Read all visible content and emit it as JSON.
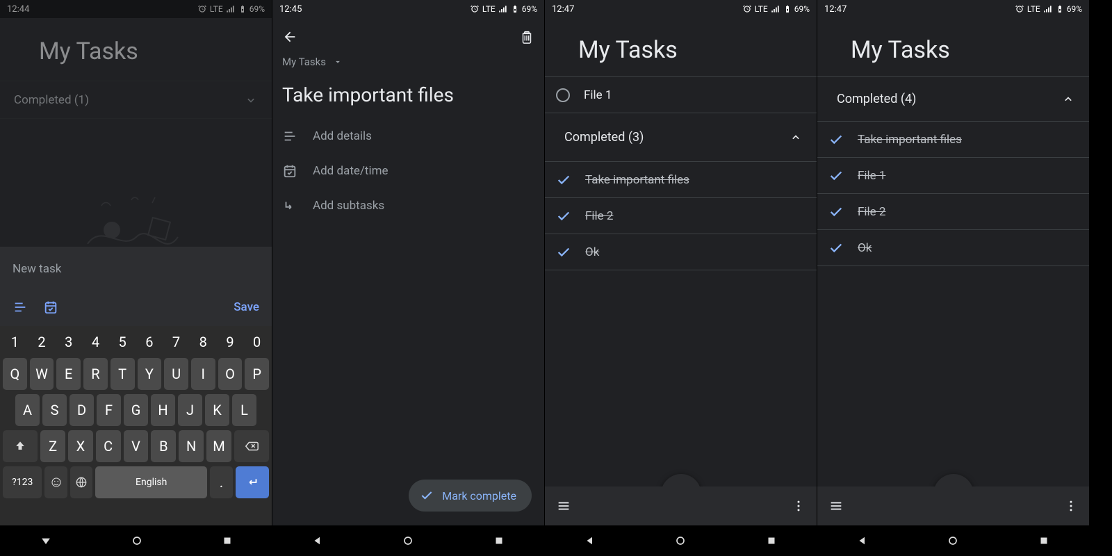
{
  "accent": "#7ea6ff",
  "status": {
    "lte": "LTE",
    "battery": "69%"
  },
  "panels": {
    "p1": {
      "time": "12:44",
      "title": "My Tasks",
      "completed_label": "Completed (1)",
      "new_task_placeholder": "New task",
      "save": "Save",
      "space_label": "English",
      "sym_label": "?123"
    },
    "p2": {
      "time": "12:45",
      "list_name": "My Tasks",
      "task_title": "Take important files",
      "add_details": "Add details",
      "add_datetime": "Add date/time",
      "add_subtasks": "Add subtasks",
      "mark_complete": "Mark complete"
    },
    "p3": {
      "time": "12:47",
      "title": "My Tasks",
      "open_task": "File 1",
      "completed_label": "Completed (3)",
      "completed_items": [
        "Take important files",
        "File 2",
        "Ok"
      ]
    },
    "p4": {
      "time": "12:47",
      "title": "My Tasks",
      "completed_label": "Completed (4)",
      "completed_items": [
        "Take important files",
        "File 1",
        "File 2",
        "Ok"
      ]
    }
  },
  "keyboard": {
    "nums": [
      "1",
      "2",
      "3",
      "4",
      "5",
      "6",
      "7",
      "8",
      "9",
      "0"
    ],
    "r1": [
      "Q",
      "W",
      "E",
      "R",
      "T",
      "Y",
      "U",
      "I",
      "O",
      "P"
    ],
    "r2": [
      "A",
      "S",
      "D",
      "F",
      "G",
      "H",
      "J",
      "K",
      "L"
    ],
    "r3": [
      "Z",
      "X",
      "C",
      "V",
      "B",
      "N",
      "M"
    ]
  }
}
